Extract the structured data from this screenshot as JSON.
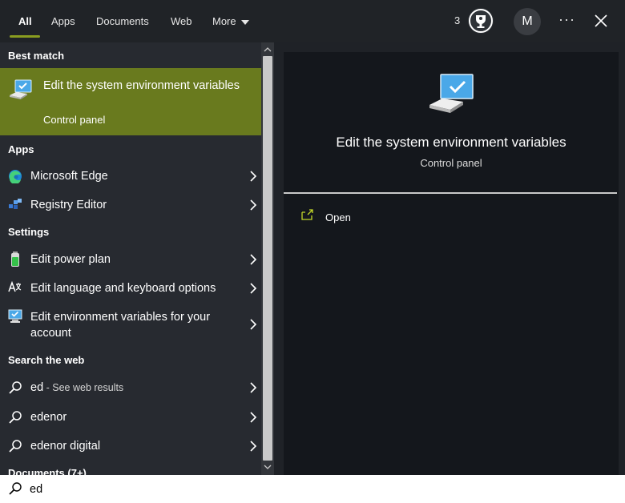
{
  "tabs": [
    {
      "label": "All"
    },
    {
      "label": "Apps"
    },
    {
      "label": "Documents"
    },
    {
      "label": "Web"
    },
    {
      "label": "More"
    }
  ],
  "header": {
    "reward_count": "3",
    "avatar_initial": "M",
    "more_glyph": "···"
  },
  "left": {
    "best_match_heading": "Best match",
    "best_match": {
      "title": "Edit the system environment variables",
      "subtitle": "Control panel"
    },
    "apps_heading": "Apps",
    "apps": [
      {
        "label": "Microsoft Edge",
        "icon": "edge-icon"
      },
      {
        "label": "Registry Editor",
        "icon": "registry-icon"
      }
    ],
    "settings_heading": "Settings",
    "settings": [
      {
        "label": "Edit power plan",
        "icon": "battery-icon"
      },
      {
        "label": "Edit language and keyboard options",
        "icon": "language-icon"
      },
      {
        "label": "Edit environment variables for your account",
        "icon": "computer-icon"
      }
    ],
    "web_heading": "Search the web",
    "web": [
      {
        "label": "ed",
        "sub": " - See web results"
      },
      {
        "label": "edenor",
        "sub": ""
      },
      {
        "label": "edenor digital",
        "sub": ""
      }
    ],
    "documents_heading": "Documents (7+)"
  },
  "preview": {
    "title": "Edit the system environment variables",
    "subtitle": "Control panel",
    "open_label": "Open"
  },
  "search": {
    "value": "ed"
  },
  "colors": {
    "accent": "#8a9d20",
    "selection": "#697a1e",
    "panel": "#272a30",
    "preview": "#14171c"
  }
}
